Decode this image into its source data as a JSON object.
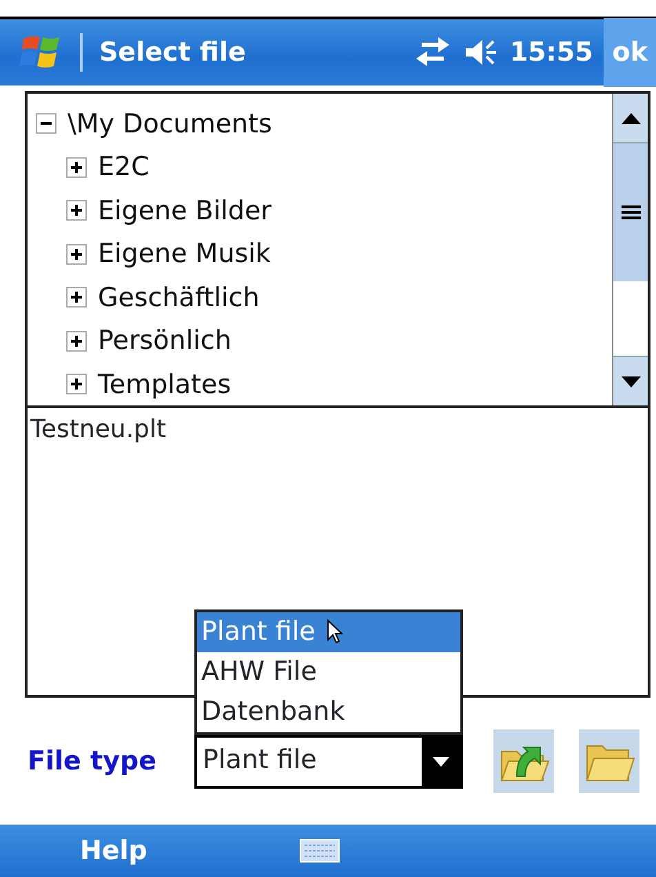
{
  "title_bar": {
    "title": "Select file",
    "time": "15:55",
    "ok_button": "ok"
  },
  "folder_tree": [
    {
      "label": "\\My Documents",
      "expanded": true,
      "children": [
        {
          "label": "E2C",
          "expanded": false
        },
        {
          "label": "Eigene Bilder",
          "expanded": false
        },
        {
          "label": "Eigene Musik",
          "expanded": false
        },
        {
          "label": "Geschäftlich",
          "expanded": false
        },
        {
          "label": "Persönlich",
          "expanded": false
        },
        {
          "label": "Templates",
          "expanded": false
        }
      ]
    }
  ],
  "files": [
    "Testneu.plt"
  ],
  "file_type": {
    "label": "File type",
    "value": "Plant file",
    "options": [
      {
        "label": "Plant file",
        "selected": true
      },
      {
        "label": "AHW File",
        "selected": false
      },
      {
        "label": "Datenbank",
        "selected": false
      }
    ]
  },
  "bottom_bar": {
    "left_softkey": "Help"
  }
}
